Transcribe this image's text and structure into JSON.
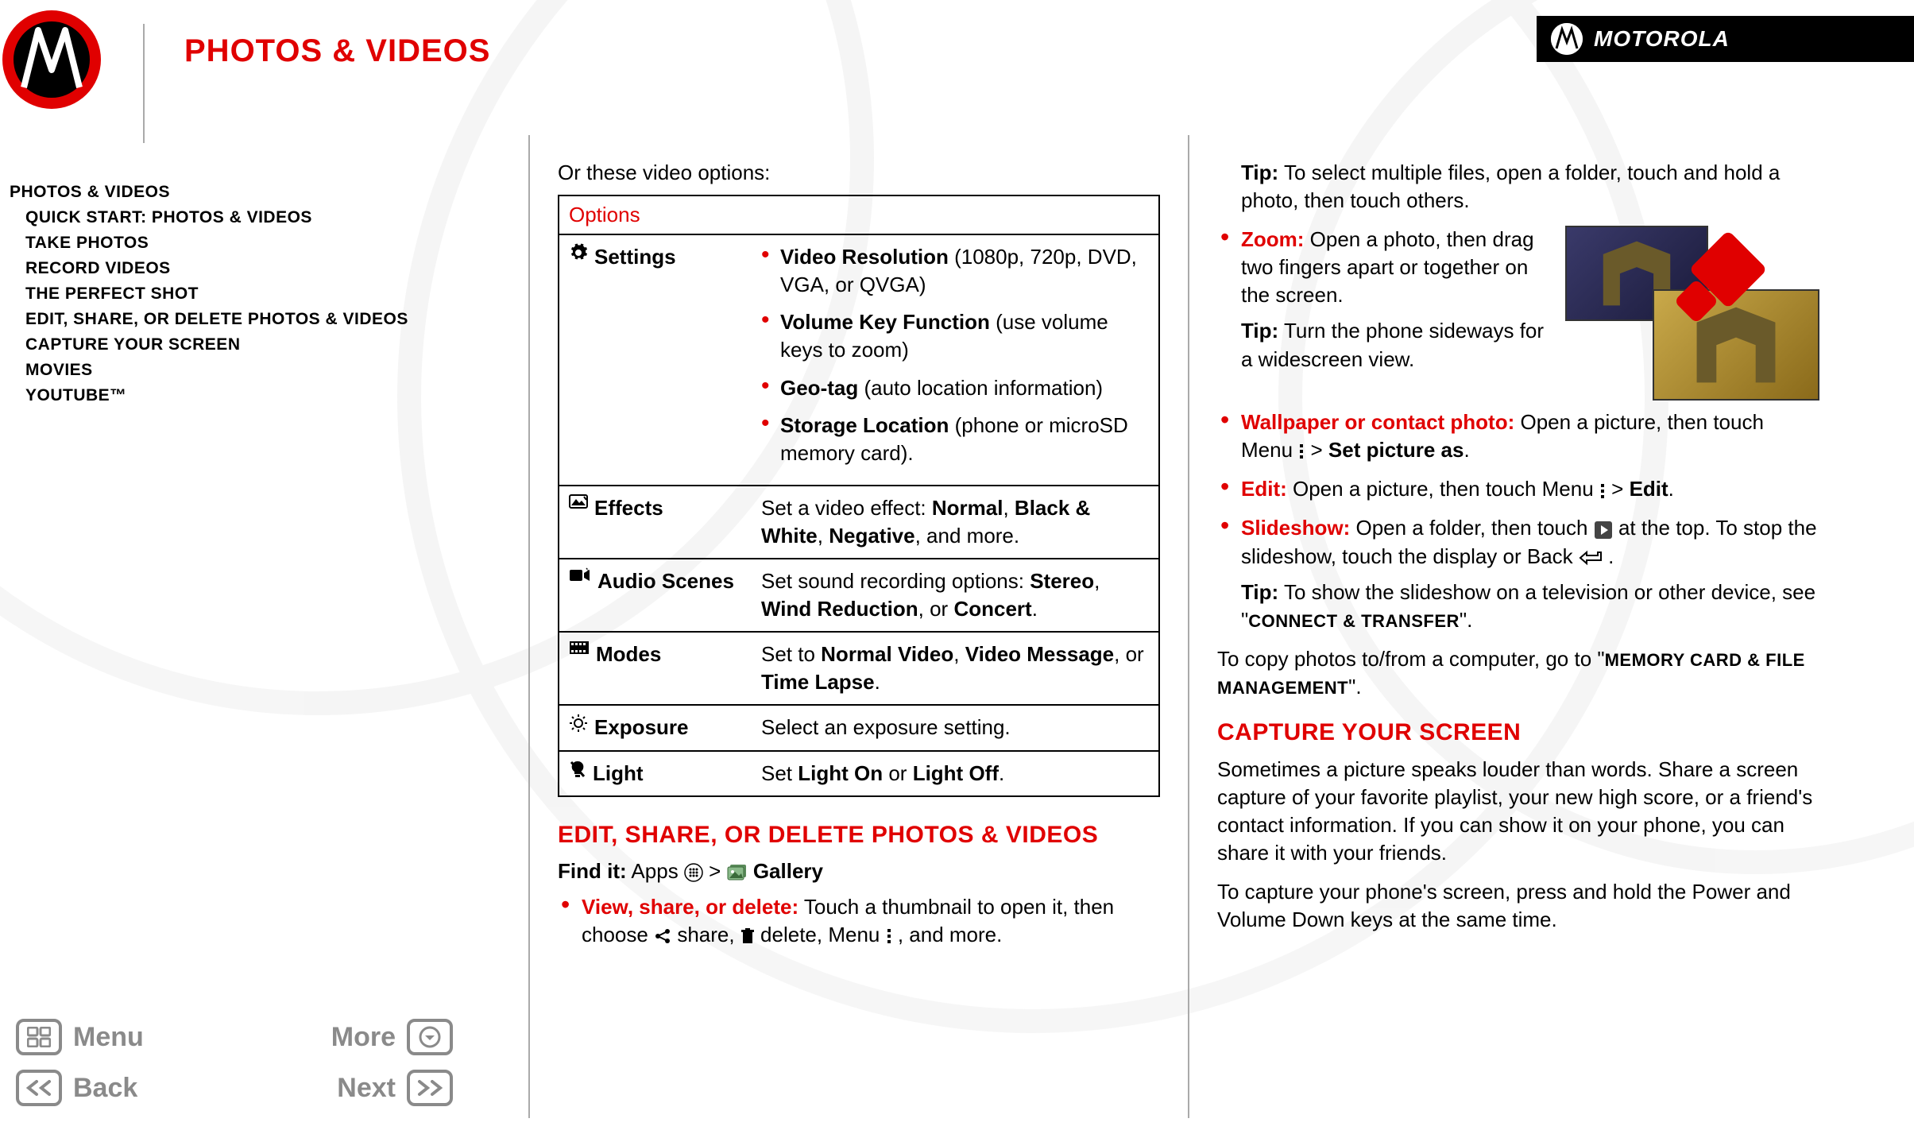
{
  "brand": "MOTOROLA",
  "page_title": "PHOTOS & VIDEOS",
  "sidebar": {
    "items": [
      {
        "label": "PHOTOS & VIDEOS",
        "indent": false
      },
      {
        "label": "QUICK START: PHOTOS & VIDEOS",
        "indent": true
      },
      {
        "label": "TAKE PHOTOS",
        "indent": true
      },
      {
        "label": "RECORD VIDEOS",
        "indent": true
      },
      {
        "label": "THE PERFECT SHOT",
        "indent": true
      },
      {
        "label": "EDIT, SHARE, OR DELETE PHOTOS & VIDEOS",
        "indent": true
      },
      {
        "label": "CAPTURE YOUR SCREEN",
        "indent": true
      },
      {
        "label": "MOVIES",
        "indent": true
      },
      {
        "label": "YOUTUBE™",
        "indent": true
      }
    ]
  },
  "nav": {
    "menu": "Menu",
    "more": "More",
    "back": "Back",
    "next": "Next"
  },
  "col1": {
    "intro": "Or these video options:",
    "options_header": "Options",
    "rows": {
      "settings": {
        "label": "Settings",
        "items": [
          {
            "bold": "Video Resolution",
            "rest": " (1080p, 720p, DVD, VGA, or QVGA)"
          },
          {
            "bold": "Volume Key Function",
            "rest": " (use volume keys to zoom)"
          },
          {
            "bold": "Geo-tag",
            "rest": " (auto location information)"
          },
          {
            "bold": "Storage Location",
            "rest": " (phone or microSD memory card)."
          }
        ]
      },
      "effects": {
        "label": "Effects",
        "pre": "Set a video effect: ",
        "b1": "Normal",
        "s1": ", ",
        "b2": "Black & White",
        "s2": ", ",
        "b3": "Negative",
        "post": ", and more."
      },
      "audio": {
        "label": "Audio Scenes",
        "pre": "Set sound recording options: ",
        "b1": "Stereo",
        "s1": ", ",
        "b2": "Wind Reduction",
        "s2": ", or ",
        "b3": "Concert",
        "post": "."
      },
      "modes": {
        "label": "Modes",
        "pre": "Set to ",
        "b1": "Normal Video",
        "s1": ", ",
        "b2": "Video Message",
        "s2": ", or ",
        "b3": "Time Lapse",
        "post": "."
      },
      "exposure": {
        "label": "Exposure",
        "desc": "Select an exposure setting."
      },
      "light": {
        "label": "Light",
        "pre": "Set ",
        "b1": "Light On",
        "s1": " or ",
        "b2": "Light Off",
        "post": "."
      }
    },
    "section_heading": "EDIT, SHARE, OR DELETE PHOTOS & VIDEOS",
    "find_label": "Find it:",
    "find_apps": " Apps ",
    "find_gt": " > ",
    "find_gallery": " Gallery",
    "bullet1_lead": "View, share, or delete:",
    "bullet1_rest": " Touch a thumbnail to open it, then choose ",
    "bullet1_share": " share, ",
    "bullet1_delete": " delete, Menu ",
    "bullet1_end": " , and more."
  },
  "col2": {
    "tip_multi_b": "Tip:",
    "tip_multi": " To select multiple files, open a folder, touch and hold a photo, then touch others.",
    "zoom_lead": "Zoom:",
    "zoom_text": " Open a photo, then drag two fingers apart or together on the screen.",
    "zoom_tip_b": "Tip:",
    "zoom_tip": " Turn the phone sideways for a widescreen view.",
    "wallpaper_lead": "Wallpaper or contact photo:",
    "wallpaper_text": " Open a picture, then touch Menu ",
    "wallpaper_gt": " > ",
    "wallpaper_set": "Set picture as",
    "wallpaper_end": ".",
    "edit_lead": "Edit:",
    "edit_text": " Open a picture, then touch Menu ",
    "edit_gt": " > ",
    "edit_b": "Edit",
    "edit_end": ".",
    "slide_lead": "Slideshow:",
    "slide_text1": " Open a folder, then touch ",
    "slide_text2": " at the top. To stop the slideshow, touch the display or Back ",
    "slide_end": ".",
    "slide_tip_b": "Tip:",
    "slide_tip1": " To show the slideshow on a television or other device, see \"",
    "slide_tip_ref": "CONNECT & TRANSFER",
    "slide_tip2": "\".",
    "copy1": "To copy photos to/from a computer, go to \"",
    "copy_ref": "MEMORY CARD & FILE MANAGEMENT",
    "copy2": "\".",
    "capture_heading": "CAPTURE YOUR SCREEN",
    "capture_p1": "Sometimes a picture speaks louder than words. Share a screen capture of your favorite playlist, your new high score, or a friend's contact information. If you can show it on your phone, you can share it with your friends.",
    "capture_p2": "To capture your phone's screen, press and hold the Power and Volume Down keys at the same time."
  }
}
